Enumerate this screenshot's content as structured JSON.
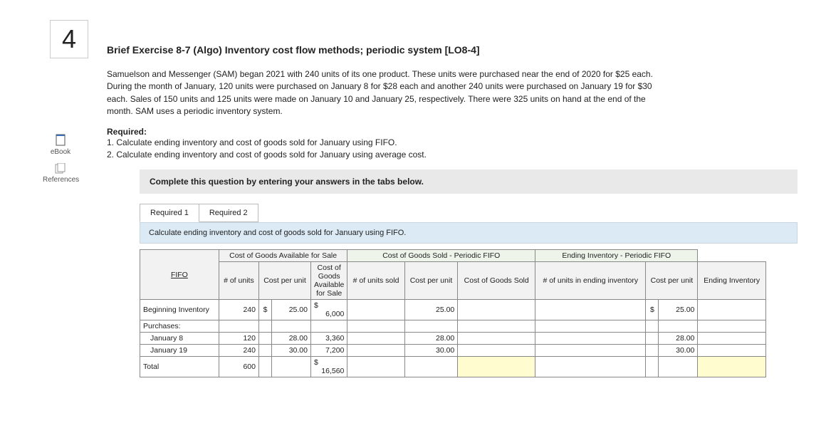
{
  "question_number": "4",
  "title": "Brief Exercise 8-7 (Algo) Inventory cost flow methods; periodic system [LO8-4]",
  "problem_text": "Samuelson and Messenger (SAM) began 2021 with 240 units of its one product. These units were purchased near the end of 2020 for $25 each. During the month of January, 120 units were purchased on January 8 for $28 each and another 240 units were purchased on January 19 for $30 each. Sales of 150 units and 125 units were made on January 10 and January 25, respectively. There were 325 units on hand at the end of the month. SAM uses a periodic inventory system.",
  "required_label": "Required:",
  "required_1": "1. Calculate ending inventory and cost of goods sold for January using FIFO.",
  "required_2": "2. Calculate ending inventory and cost of goods sold for January using average cost.",
  "sidebar": {
    "book": "eBook",
    "references": "References"
  },
  "instruction_bar": "Complete this question by entering your answers in the tabs below.",
  "tabs": {
    "t1": "Required 1",
    "t2": "Required 2"
  },
  "sub_instruction": "Calculate ending inventory and cost of goods sold for January using FIFO.",
  "table": {
    "method_label": "FIFO",
    "group_headers": {
      "g1": "Cost of Goods Available for Sale",
      "g2": "Cost of Goods Sold - Periodic FIFO",
      "g3": "Ending Inventory - Periodic FIFO"
    },
    "col_headers": {
      "c1": "# of units",
      "c2": "Cost per unit",
      "c3": "Cost of Goods Available for Sale",
      "c4": "# of units sold",
      "c5": "Cost per unit",
      "c6": "Cost of Goods Sold",
      "c7": "# of units in ending inventory",
      "c8": "Cost per unit",
      "c9": "Ending Inventory"
    },
    "rows": {
      "beginning": {
        "label": "Beginning Inventory",
        "units": "240",
        "cost_per": "25.00",
        "available": "6,000",
        "sold_cost_per": "25.00",
        "end_cost_per": "25.00"
      },
      "purchases_label": "Purchases:",
      "jan8": {
        "label": "January 8",
        "units": "120",
        "cost_per": "28.00",
        "available": "3,360",
        "sold_cost_per": "28.00",
        "end_cost_per": "28.00"
      },
      "jan19": {
        "label": "January 19",
        "units": "240",
        "cost_per": "30.00",
        "available": "7,200",
        "sold_cost_per": "30.00",
        "end_cost_per": "30.00"
      },
      "total": {
        "label": "Total",
        "units": "600",
        "available": "16,560"
      }
    },
    "dollar": "$"
  }
}
